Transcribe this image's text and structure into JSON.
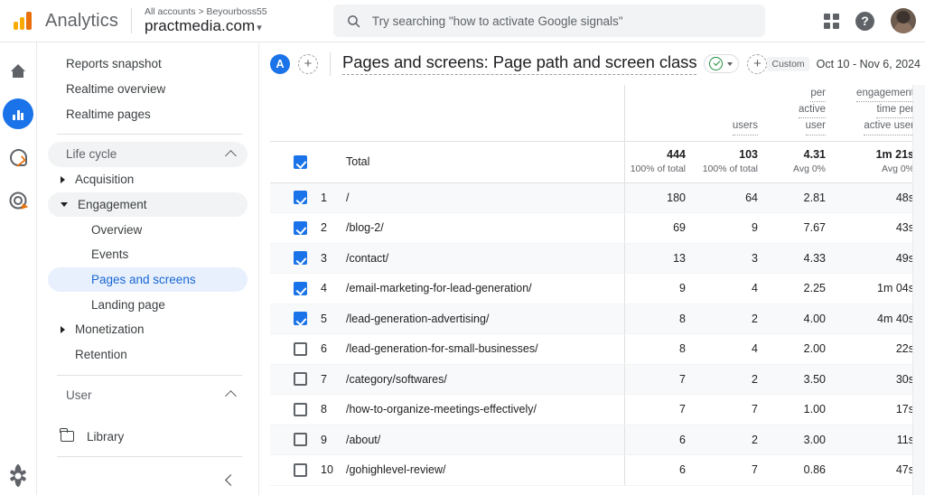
{
  "topbar": {
    "brand": "Analytics",
    "account_breadcrumb": "All accounts > Beyourboss55",
    "property": "practmedia.com",
    "property_caret": "▾",
    "search_placeholder": "Try searching \"how to activate Google signals\"",
    "help_label": "?"
  },
  "nav": {
    "items": [
      {
        "label": "Reports snapshot"
      },
      {
        "label": "Realtime overview"
      },
      {
        "label": "Realtime pages"
      }
    ],
    "lifecycle_section": "Life cycle",
    "lifecycle_items": [
      {
        "label": "Acquisition"
      },
      {
        "label": "Engagement"
      },
      {
        "label": "Overview"
      },
      {
        "label": "Events"
      },
      {
        "label": "Pages and screens"
      },
      {
        "label": "Landing page"
      },
      {
        "label": "Monetization"
      },
      {
        "label": "Retention"
      }
    ],
    "user_section": "User",
    "library_label": "Library"
  },
  "report": {
    "badge": "A",
    "title": "Pages and screens: Page path and screen class",
    "date_chip": "Custom",
    "date_range": "Oct 10 - Nov 6, 2024"
  },
  "table": {
    "headers": [
      "",
      "",
      "",
      "users",
      "",
      "per\nactive\nuser",
      "engagement\ntime per\nactive user"
    ],
    "header_col4": "users",
    "header_col5_l1": "per",
    "header_col5_l2": "active",
    "header_col5_l3": "user",
    "header_col6_l1": "engagement",
    "header_col6_l2": "time per",
    "header_col6_l3": "active user",
    "total_label": "Total",
    "totals": [
      {
        "value": "444",
        "sub": "100% of total"
      },
      {
        "value": "103",
        "sub": "100% of total"
      },
      {
        "value": "4.31",
        "sub": "Avg 0%"
      },
      {
        "value": "1m 21s",
        "sub": "Avg 0%"
      }
    ],
    "rows": [
      {
        "checked": true,
        "rank": "1",
        "path": "/",
        "v1": "180",
        "v2": "64",
        "v3": "2.81",
        "v4": "48s"
      },
      {
        "checked": true,
        "rank": "2",
        "path": "/blog-2/",
        "v1": "69",
        "v2": "9",
        "v3": "7.67",
        "v4": "43s"
      },
      {
        "checked": true,
        "rank": "3",
        "path": "/contact/",
        "v1": "13",
        "v2": "3",
        "v3": "4.33",
        "v4": "49s"
      },
      {
        "checked": true,
        "rank": "4",
        "path": "/email-marketing-for-lead-generation/",
        "v1": "9",
        "v2": "4",
        "v3": "2.25",
        "v4": "1m 04s"
      },
      {
        "checked": true,
        "rank": "5",
        "path": "/lead-generation-advertising/",
        "v1": "8",
        "v2": "2",
        "v3": "4.00",
        "v4": "4m 40s"
      },
      {
        "checked": false,
        "rank": "6",
        "path": "/lead-generation-for-small-businesses/",
        "v1": "8",
        "v2": "4",
        "v3": "2.00",
        "v4": "22s"
      },
      {
        "checked": false,
        "rank": "7",
        "path": "/category/softwares/",
        "v1": "7",
        "v2": "2",
        "v3": "3.50",
        "v4": "30s"
      },
      {
        "checked": false,
        "rank": "8",
        "path": "/how-to-organize-meetings-effectively/",
        "v1": "7",
        "v2": "7",
        "v3": "1.00",
        "v4": "17s"
      },
      {
        "checked": false,
        "rank": "9",
        "path": "/about/",
        "v1": "6",
        "v2": "2",
        "v3": "3.00",
        "v4": "11s"
      },
      {
        "checked": false,
        "rank": "10",
        "path": "/gohighlevel-review/",
        "v1": "6",
        "v2": "7",
        "v3": "0.86",
        "v4": "47s"
      }
    ]
  },
  "colors": {
    "brand_blue": "#1a73e8",
    "brand_orange": "#e8710a",
    "brand_yellow": "#f9ab00",
    "selected_bg": "#e8f0fe",
    "selected_text": "#1967d2",
    "green": "#1e8e3e"
  }
}
